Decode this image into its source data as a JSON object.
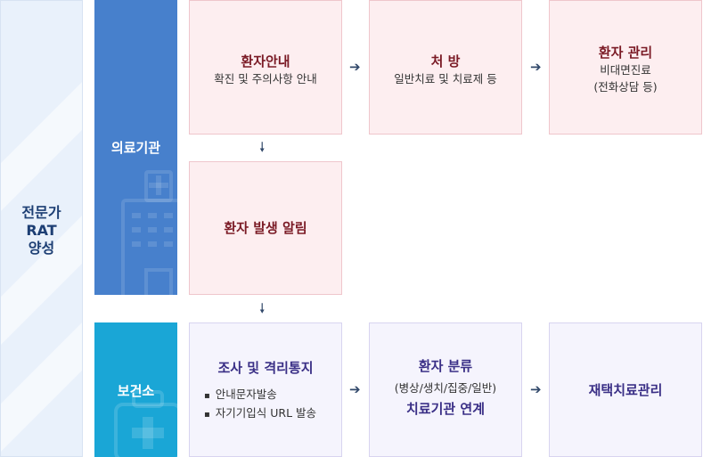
{
  "left": {
    "label": "전문가\nRAT\n양성"
  },
  "orgs": {
    "hospital": "의료기관",
    "health_center": "보건소"
  },
  "hospital_flow": {
    "guide": {
      "title": "환자안내",
      "sub": "확진 및 주의사항 안내"
    },
    "prescription": {
      "title": "처 방",
      "sub": "일반치료 및 치료제 등"
    },
    "management": {
      "title": "환자 관리",
      "sub": "비대면진료\n(전화상담 등)"
    },
    "notify": {
      "title": "환자 발생 알림"
    }
  },
  "health_flow": {
    "investigate": {
      "title": "조사 및 격리통지",
      "bullets": [
        "안내문자발송",
        "자기기입식 URL 발송"
      ]
    },
    "classify": {
      "title": "환자 분류",
      "sub": "(병상/생치/집중/일반)",
      "title2": "치료기관 연계"
    },
    "home_care": {
      "title": "재택치료관리"
    }
  },
  "colors": {
    "hospital": "#4780cc",
    "health_center": "#1aa6d6",
    "pink_box": "#fdeef0",
    "lavender_box": "#f5f4fd",
    "left_bg": "#e9f1fb"
  }
}
